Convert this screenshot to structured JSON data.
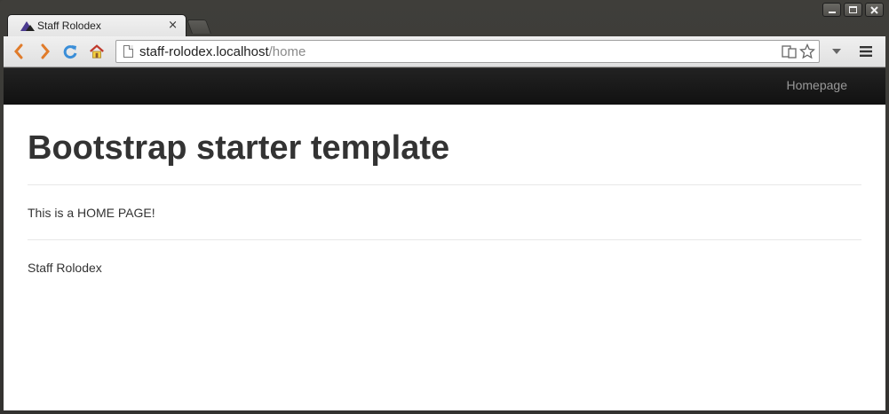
{
  "browser": {
    "tab_title": "Staff Rolodex",
    "tab_close": "×",
    "url_host": "staff-rolodex.localhost",
    "url_path": "/home"
  },
  "icons": {
    "back": "back-arrow-icon",
    "forward": "forward-arrow-icon",
    "reload": "reload-icon",
    "home": "home-icon",
    "page": "page-icon",
    "reader": "reader-mode-icon",
    "star": "star-icon",
    "dropdown": "chevron-down-icon",
    "menu": "menu-icon"
  },
  "colors": {
    "navbar": "#1b1b1b",
    "nav_link": "#999999",
    "heading": "#333333",
    "back_arrow": "#e07b2a",
    "reload": "#3a8ed8"
  },
  "navbar": {
    "homepage_link": "Homepage"
  },
  "page": {
    "title": "Bootstrap starter template",
    "body_text": "This is a HOME PAGE!",
    "footer": "Staff Rolodex"
  }
}
